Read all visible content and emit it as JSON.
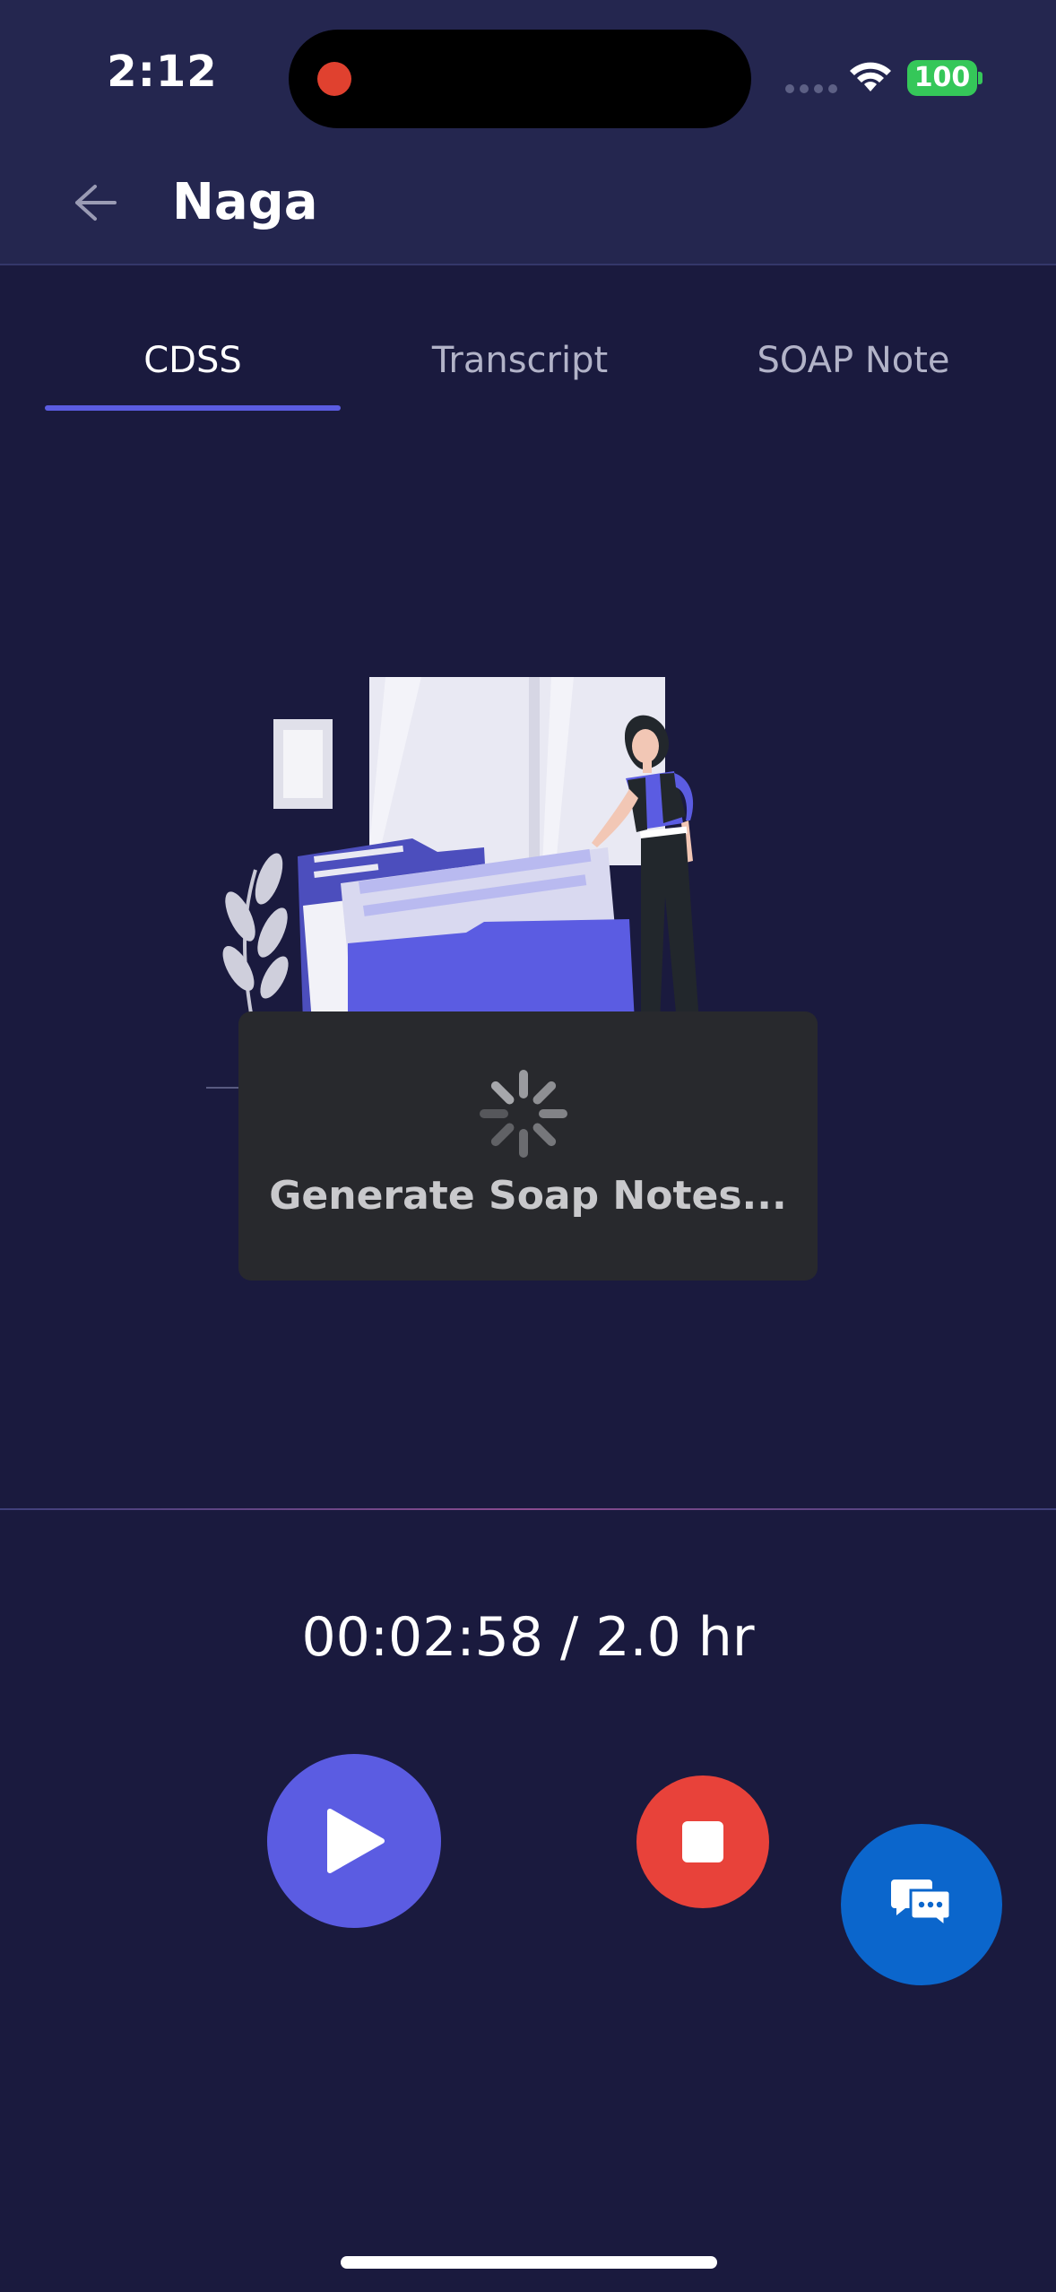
{
  "status_bar": {
    "time": "2:12",
    "battery": "100"
  },
  "header": {
    "title": "Naga"
  },
  "tabs": [
    {
      "label": "CDSS",
      "active": true
    },
    {
      "label": "Transcript",
      "active": false
    },
    {
      "label": "SOAP Note",
      "active": false
    }
  ],
  "loading": {
    "text": "Generate Soap Notes..."
  },
  "recorder": {
    "timer": "00:02:58 / 2.0 hr"
  },
  "colors": {
    "background": "#1a1a3e",
    "header": "#24264f",
    "accent": "#5b5ce2",
    "stop": "#e8423a",
    "chat": "#0b66cc",
    "battery": "#35c759",
    "recording": "#e0412f"
  },
  "icons": {
    "back": "arrow-left-icon",
    "spinner": "spinner-icon",
    "play": "play-icon",
    "stop": "stop-icon",
    "chat": "chat-bubbles-icon",
    "wifi": "wifi-icon"
  }
}
